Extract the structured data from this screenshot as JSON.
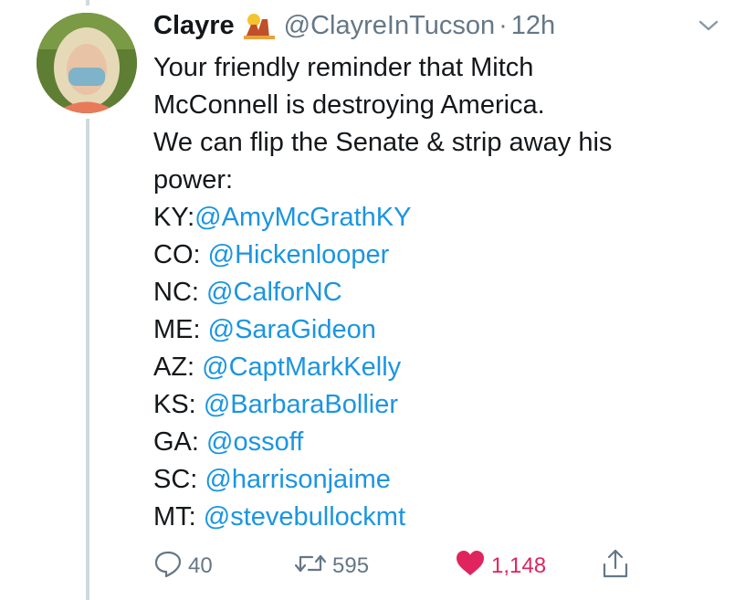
{
  "tweet": {
    "display_name": "Clayre",
    "handle": "@ClayreInTucson",
    "separator": "·",
    "time": "12h",
    "text_lines": [
      "Your friendly reminder that Mitch",
      "McConnell is destroying America.",
      "We can flip the Senate & strip away his",
      "power:"
    ],
    "mentions": [
      {
        "prefix": "KY:",
        "mention": "@AmyMcGrathKY"
      },
      {
        "prefix": "CO: ",
        "mention": "@Hickenlooper"
      },
      {
        "prefix": "NC: ",
        "mention": "@CalforNC"
      },
      {
        "prefix": "ME: ",
        "mention": "@SaraGideon"
      },
      {
        "prefix": "AZ: ",
        "mention": "@CaptMarkKelly"
      },
      {
        "prefix": "KS: ",
        "mention": "@BarbaraBollier"
      },
      {
        "prefix": "GA: ",
        "mention": "@ossoff"
      },
      {
        "prefix": "SC: ",
        "mention": "@harrisonjaime"
      },
      {
        "prefix": "MT: ",
        "mention": "@stevebullockmt"
      }
    ]
  },
  "actions": {
    "reply_count": "40",
    "retweet_count": "595",
    "like_count": "1,148"
  },
  "colors": {
    "link": "#1b95e0",
    "like": "#e0245e",
    "muted": "#657786"
  },
  "icons": [
    "caret-down-icon",
    "desert-emoji-icon",
    "reply-icon",
    "retweet-icon",
    "heart-icon",
    "share-icon"
  ]
}
